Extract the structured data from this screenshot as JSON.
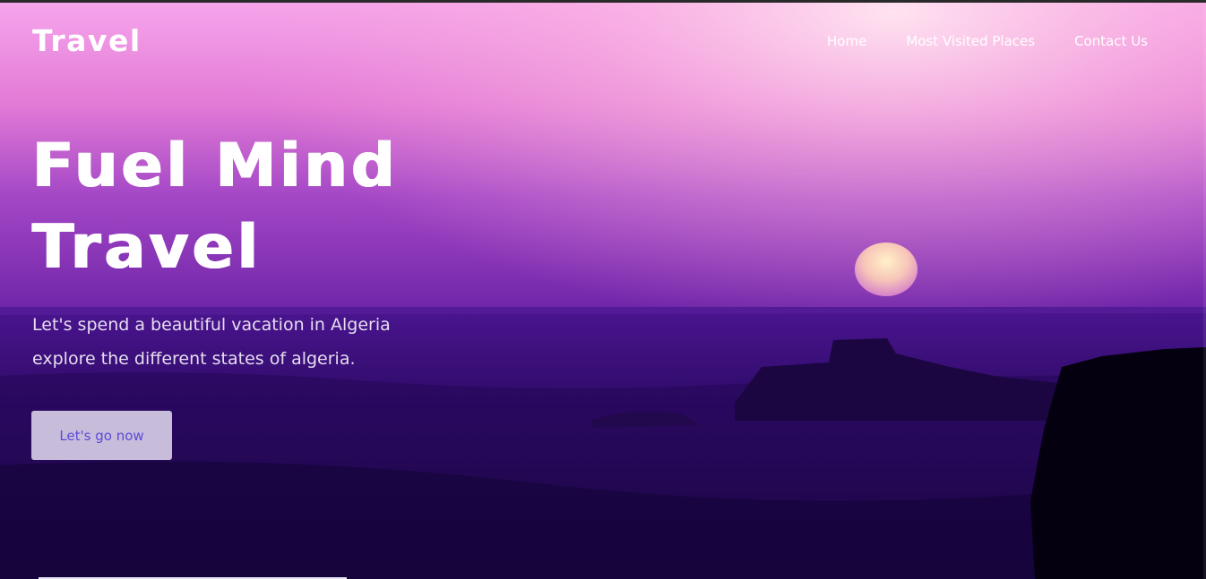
{
  "brand": {
    "logo_text": "Travel"
  },
  "nav": {
    "items": [
      {
        "label": "Home"
      },
      {
        "label": "Most Visited Places"
      },
      {
        "label": "Contact Us"
      }
    ]
  },
  "hero": {
    "title_line1": "Fuel Mind",
    "title_line2": "Travel",
    "subtitle": "Let's spend a beautiful vacation in Algeria explore the different states of algeria.",
    "cta_label": "Let's go now",
    "background_image": "sunset-over-desert-landscape"
  },
  "colors": {
    "sky_top": "#f6a8e6",
    "sky_mid": "#9a3fc7",
    "ground": "#22074a",
    "cta_text": "#5b4ad6"
  }
}
